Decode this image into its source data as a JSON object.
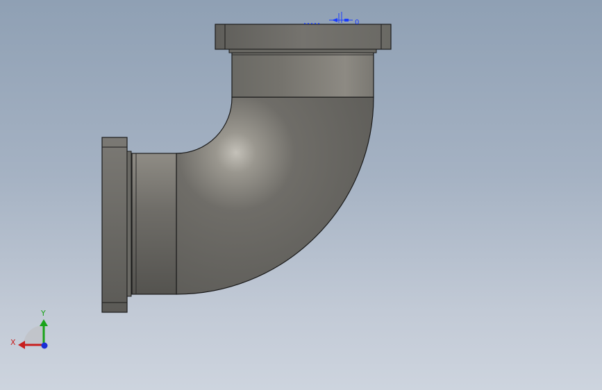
{
  "viewport": {
    "model": {
      "part": "pipe-elbow-90",
      "body_color": "#6c6b66",
      "highlight_color": "#bdbab2",
      "flange_color": "#6e6d68",
      "edge_color": "#1a1a1a"
    },
    "annotation": {
      "color": "#1a3cff",
      "text": "0"
    },
    "triad": {
      "x_label": "X",
      "y_label": "Y",
      "x_color": "#c81e1e",
      "y_color": "#1aa31a",
      "z_color": "#1a2fd6"
    }
  }
}
